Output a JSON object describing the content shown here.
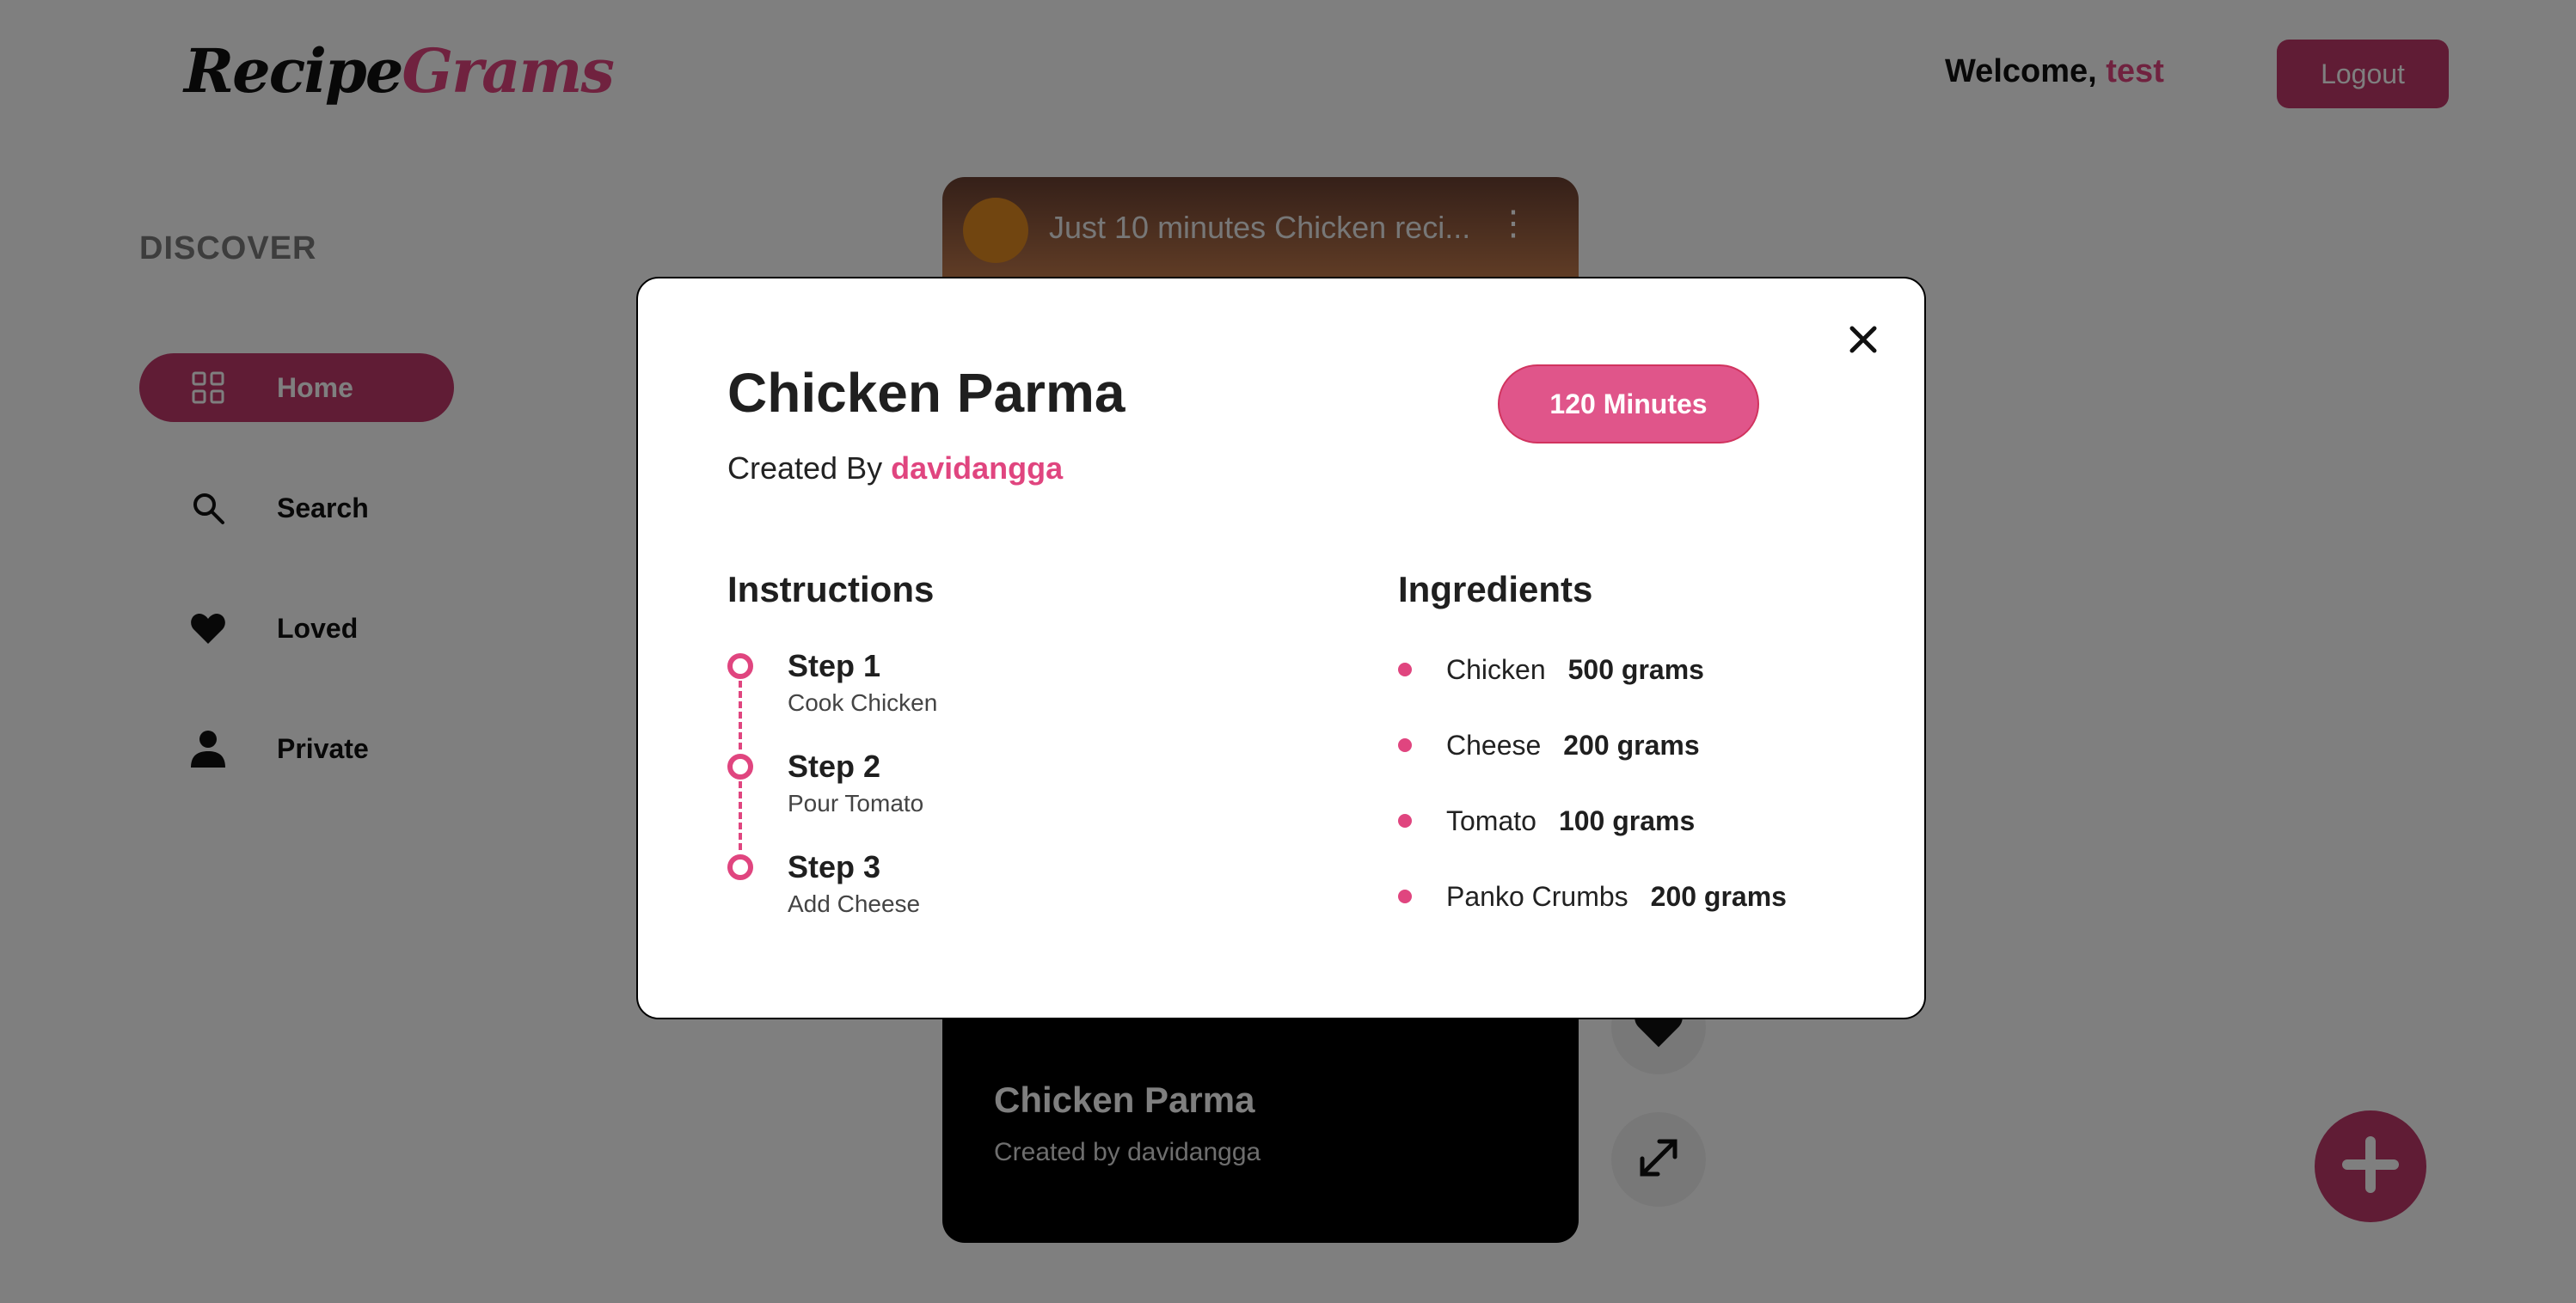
{
  "header": {
    "logo_part1": "Recipe",
    "logo_part2": "Grams",
    "welcome_prefix": "Welcome,",
    "username": "test",
    "logout_label": "Logout"
  },
  "sidebar": {
    "title": "DISCOVER",
    "items": [
      {
        "label": "Home",
        "icon": "grid-icon",
        "active": true
      },
      {
        "label": "Search",
        "icon": "search-icon",
        "active": false
      },
      {
        "label": "Loved",
        "icon": "heart-icon",
        "active": false
      },
      {
        "label": "Private",
        "icon": "person-icon",
        "active": false
      }
    ]
  },
  "card": {
    "video_title": "Just 10 minutes Chicken reci...",
    "title": "Chicken Parma",
    "subtitle": "Created by davidangga"
  },
  "modal": {
    "title": "Chicken Parma",
    "created_by_prefix": "Created By",
    "author": "davidangga",
    "duration_label": "120 Minutes",
    "instructions_heading": "Instructions",
    "ingredients_heading": "Ingredients",
    "steps": [
      {
        "title": "Step 1",
        "desc": "Cook Chicken"
      },
      {
        "title": "Step 2",
        "desc": "Pour Tomato"
      },
      {
        "title": "Step 3",
        "desc": "Add Cheese"
      }
    ],
    "ingredients": [
      {
        "name": "Chicken",
        "qty": "500 grams"
      },
      {
        "name": "Cheese",
        "qty": "200 grams"
      },
      {
        "name": "Tomato",
        "qty": "100 grams"
      },
      {
        "name": "Panko Crumbs",
        "qty": "200 grams"
      }
    ]
  },
  "colors": {
    "accent": "#e0457f",
    "accent_dark": "#c0386a"
  }
}
